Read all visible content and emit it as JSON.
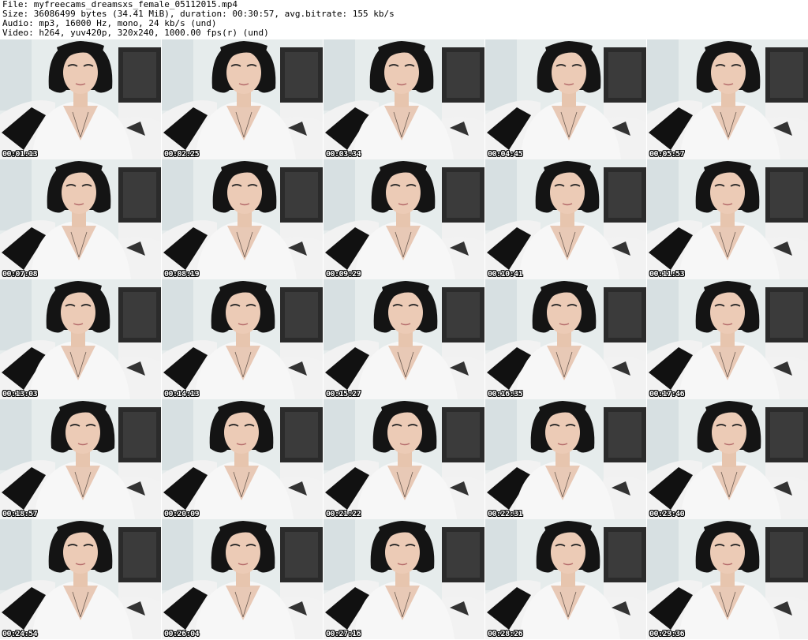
{
  "header": {
    "file": "File: myfreecams_dreamsxs_female_05112015.mp4",
    "size": "Size: 36086499 bytes (34.41 MiB), duration: 00:30:57, avg.bitrate: 155 kb/s",
    "audio": "Audio: mp3, 16000 Hz, mono, 24 kb/s (und)",
    "video": "Video: h264, yuv420p, 320x240, 1000.00 fps(r) (und)"
  },
  "thumbnails": [
    {
      "timestamp": "00:01:13"
    },
    {
      "timestamp": "00:02:25"
    },
    {
      "timestamp": "00:03:34"
    },
    {
      "timestamp": "00:04:45"
    },
    {
      "timestamp": "00:05:57"
    },
    {
      "timestamp": "00:07:08"
    },
    {
      "timestamp": "00:08:19"
    },
    {
      "timestamp": "00:09:29"
    },
    {
      "timestamp": "00:10:41"
    },
    {
      "timestamp": "00:11:53"
    },
    {
      "timestamp": "00:13:03"
    },
    {
      "timestamp": "00:14:13"
    },
    {
      "timestamp": "00:15:27"
    },
    {
      "timestamp": "00:16:35"
    },
    {
      "timestamp": "00:17:46"
    },
    {
      "timestamp": "00:18:57"
    },
    {
      "timestamp": "00:20:09"
    },
    {
      "timestamp": "00:21:22"
    },
    {
      "timestamp": "00:22:31"
    },
    {
      "timestamp": "00:23:40"
    },
    {
      "timestamp": "00:24:54"
    },
    {
      "timestamp": "00:26:04"
    },
    {
      "timestamp": "00:27:16"
    },
    {
      "timestamp": "00:28:26"
    },
    {
      "timestamp": "00:29:36"
    }
  ]
}
